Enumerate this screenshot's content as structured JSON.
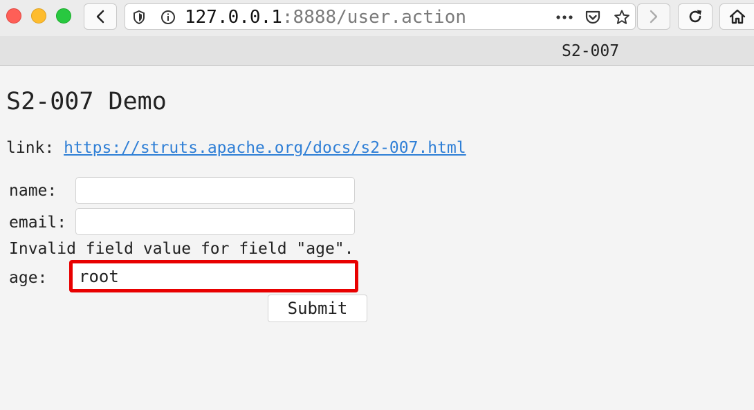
{
  "browser": {
    "url_host": "127.0.0.1",
    "url_rest": ":8888/user.action",
    "tab_title": "S2-007",
    "icons": [
      "back-arrow-icon",
      "shield-icon",
      "info-icon",
      "more-icon",
      "pocket-icon",
      "star-icon",
      "forward-arrow-icon",
      "reload-icon",
      "home-icon"
    ]
  },
  "page": {
    "title": "S2-007 Demo",
    "link_label": "link:",
    "link_text": "https://struts.apache.org/docs/s2-007.html"
  },
  "form": {
    "name_label": "name:",
    "name_value": "",
    "email_label": "email:",
    "email_value": "",
    "error_message": "Invalid field value for field \"age\".",
    "age_label": "age:",
    "age_value": "root",
    "submit_label": "Submit",
    "highlight_color": "#e80000"
  }
}
